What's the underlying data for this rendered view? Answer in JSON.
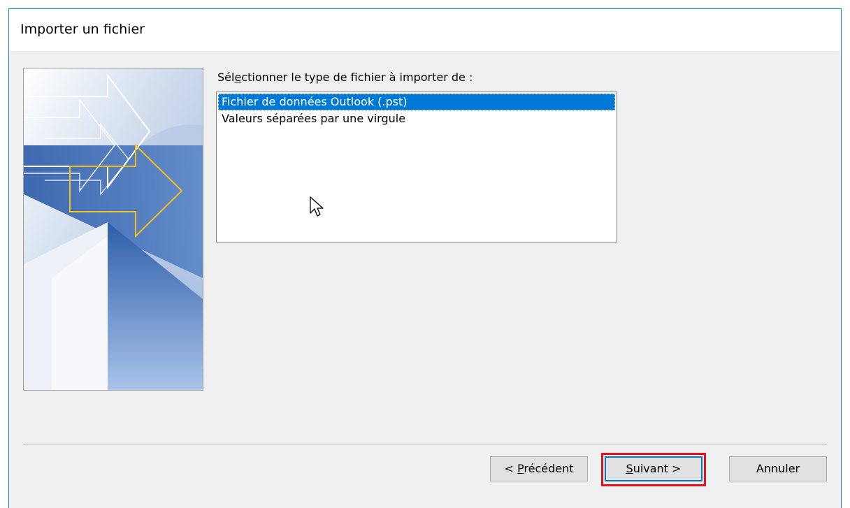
{
  "window": {
    "title": "Importer un fichier"
  },
  "prompt": {
    "before": "Sél",
    "mnemonic": "e",
    "after": "ctionner le type de fichier à importer de :"
  },
  "file_types": [
    {
      "label": "Fichier de données Outlook (.pst)",
      "selected": true
    },
    {
      "label": "Valeurs séparées par une virgule",
      "selected": false
    }
  ],
  "buttons": {
    "previous": {
      "before": "< ",
      "mnemonic": "P",
      "after": "récédent"
    },
    "next": {
      "before": "",
      "mnemonic": "S",
      "after": "uivant >"
    },
    "cancel": {
      "label": "Annuler"
    }
  },
  "colors": {
    "accent": "#0078d7",
    "border": "#1883d7",
    "highlight": "#e0141e",
    "arrow": "#f2c21b"
  },
  "icons": {
    "cursor": "mouse-pointer-icon",
    "wizard_art": "import-arrows-graphic"
  }
}
